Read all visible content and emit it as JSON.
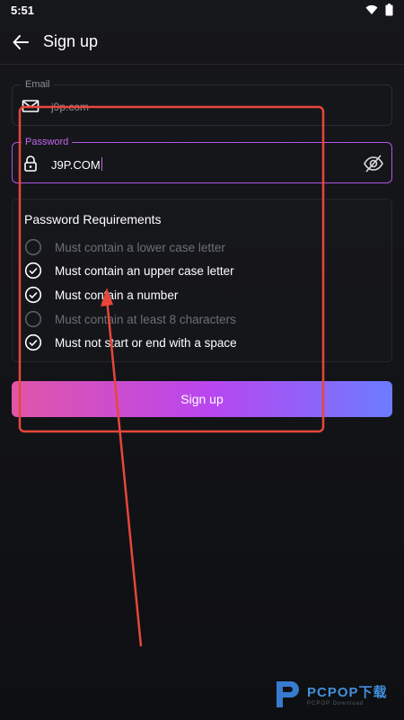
{
  "status": {
    "time": "5:51"
  },
  "header": {
    "title": "Sign up"
  },
  "email": {
    "label": "Email",
    "value": "j9p.com"
  },
  "password": {
    "label": "Password",
    "value": "J9P.COM"
  },
  "requirements": {
    "title": "Password Requirements",
    "items": [
      {
        "label": "Must contain a lower case letter",
        "met": false
      },
      {
        "label": "Must contain an upper case letter",
        "met": true
      },
      {
        "label": "Must contain a number",
        "met": true
      },
      {
        "label": "Must contain at least 8 characters",
        "met": false
      },
      {
        "label": "Must not start or end with a space",
        "met": true
      }
    ]
  },
  "signup_button": {
    "label": "Sign up"
  },
  "colors": {
    "accent": "#b455e6",
    "gradient_start": "#e056a8",
    "gradient_end": "#6c7cff",
    "annotation": "#e8463a"
  },
  "watermark": {
    "main": "PCPOP下载",
    "sub": "PCPOP Download"
  }
}
